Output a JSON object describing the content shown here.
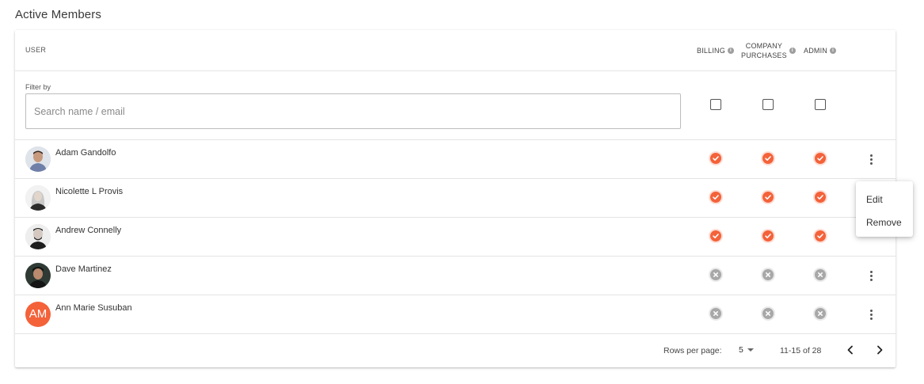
{
  "page": {
    "title": "Active Members"
  },
  "table": {
    "columns": {
      "user": "USER",
      "billing": "BILLING",
      "company_purchases_line1": "COMPANY",
      "company_purchases_line2": "PURCHASES",
      "admin": "ADMIN"
    },
    "filter": {
      "label": "Filter by",
      "placeholder": "Search name / email",
      "value": ""
    },
    "members": [
      {
        "name": "Adam Gandolfo",
        "avatar": "photo",
        "billing": true,
        "company_purchases": true,
        "admin": true
      },
      {
        "name": "Nicolette L Provis",
        "avatar": "photo",
        "billing": true,
        "company_purchases": true,
        "admin": true
      },
      {
        "name": "Andrew Connelly",
        "avatar": "photo",
        "billing": true,
        "company_purchases": true,
        "admin": true
      },
      {
        "name": "Dave Martinez",
        "avatar": "photo",
        "billing": false,
        "company_purchases": false,
        "admin": false
      },
      {
        "name": "Ann Marie Susuban",
        "avatar": "initials",
        "initials": "AM",
        "billing": false,
        "company_purchases": false,
        "admin": false
      }
    ]
  },
  "pagination": {
    "rows_per_page_label": "Rows per page:",
    "rows_per_page": "5",
    "range": "11-15 of 28"
  },
  "context_menu": {
    "items": [
      "Edit",
      "Remove"
    ]
  },
  "colors": {
    "accent": "#f4623a",
    "inactive": "#a8a8a8"
  },
  "icons": {
    "info": "info-icon",
    "enabled": "check-circle-icon",
    "disabled": "x-circle-icon",
    "more": "more-vertical-icon",
    "prev": "chevron-left-icon",
    "next": "chevron-right-icon",
    "dropdown": "caret-down-icon"
  }
}
